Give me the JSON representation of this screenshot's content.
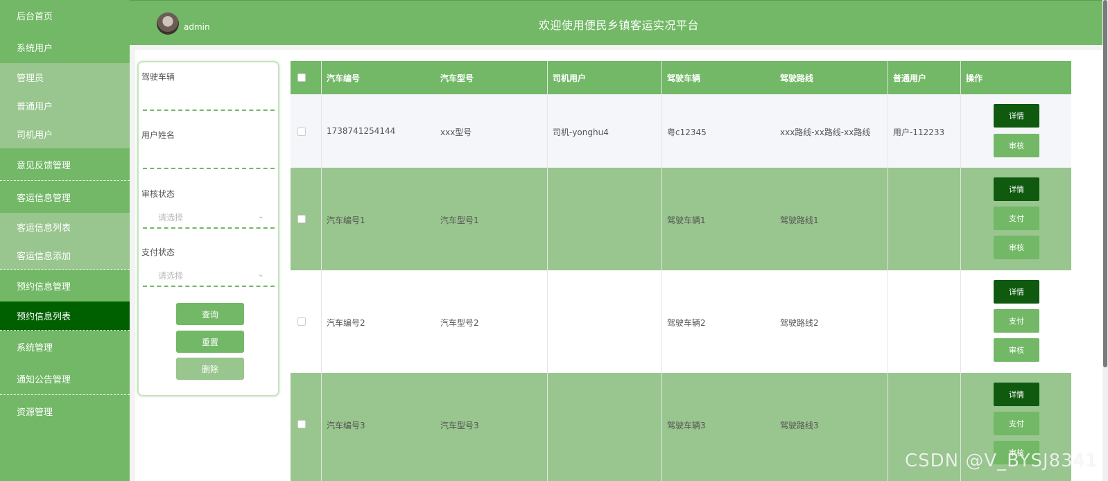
{
  "sidebar": {
    "items": [
      {
        "label": "后台首页"
      },
      {
        "label": "系统用户"
      },
      {
        "label": "管理员"
      },
      {
        "label": "普通用户"
      },
      {
        "label": "司机用户"
      },
      {
        "label": "意见反馈管理"
      },
      {
        "label": "客运信息管理"
      },
      {
        "label": "客运信息列表"
      },
      {
        "label": "客运信息添加"
      },
      {
        "label": "预约信息管理"
      },
      {
        "label": "预约信息列表"
      },
      {
        "label": "系统管理"
      },
      {
        "label": "通知公告管理"
      },
      {
        "label": "资源管理"
      }
    ]
  },
  "header": {
    "username": "admin",
    "title": "欢迎使用便民乡镇客运实况平台"
  },
  "search": {
    "vehicle_label": "驾驶车辆",
    "username_label": "用户姓名",
    "audit_label": "审核状态",
    "audit_placeholder": "请选择",
    "pay_label": "支付状态",
    "pay_placeholder": "请选择",
    "query_button": "查询",
    "reset_button": "重置",
    "delete_button": "删除"
  },
  "table": {
    "headers": [
      "汽车编号",
      "汽车型号",
      "司机用户",
      "驾驶车辆",
      "驾驶路线",
      "普通用户",
      "操作"
    ],
    "rows": [
      {
        "car_no": "1738741254144",
        "car_model": "xxx型号",
        "driver": "司机-yonghu4",
        "vehicle": "粤c12345",
        "route": "xxx路线-xx路线-xx路线",
        "user": "用户-112233",
        "buttons": [
          "详情",
          "审核"
        ]
      },
      {
        "car_no": "汽车编号1",
        "car_model": "汽车型号1",
        "driver": "",
        "vehicle": "驾驶车辆1",
        "route": "驾驶路线1",
        "user": "",
        "buttons": [
          "详情",
          "支付",
          "审核"
        ]
      },
      {
        "car_no": "汽车编号2",
        "car_model": "汽车型号2",
        "driver": "",
        "vehicle": "驾驶车辆2",
        "route": "驾驶路线2",
        "user": "",
        "buttons": [
          "详情",
          "支付",
          "审核"
        ]
      },
      {
        "car_no": "汽车编号3",
        "car_model": "汽车型号3",
        "driver": "",
        "vehicle": "驾驶车辆3",
        "route": "驾驶路线3",
        "user": "",
        "buttons": [
          "详情",
          "支付",
          "审核"
        ]
      }
    ]
  },
  "watermark": "CSDN @V_BYSJ8341",
  "colors": {
    "primary": "#72b866",
    "light": "#98c68e",
    "active": "#006000",
    "dark_button": "#0f5a0f"
  }
}
